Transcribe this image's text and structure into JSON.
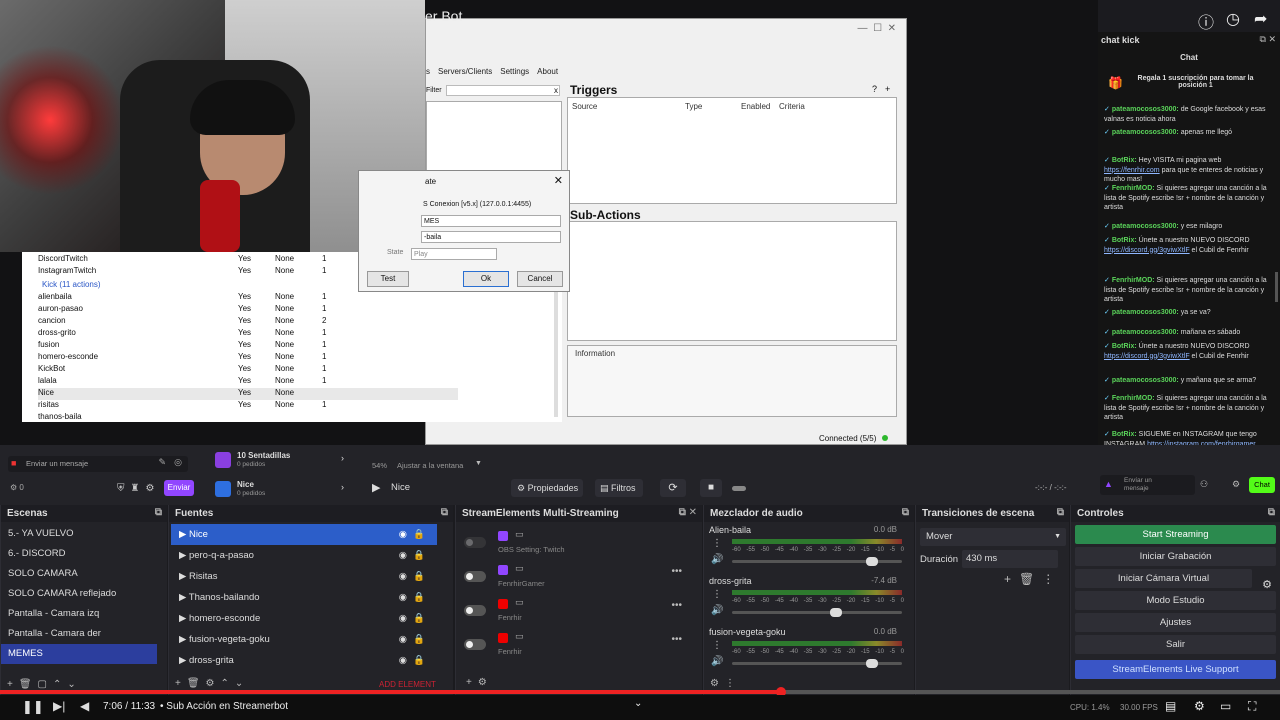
{
  "app": {
    "title": "er Bot"
  },
  "topicons": [
    "info-icon",
    "clock-icon",
    "share-icon"
  ],
  "sb": {
    "menu": [
      "s",
      "Servers/Clients",
      "Settings",
      "About"
    ],
    "filter_label": "Filter",
    "triggers_title": "Triggers",
    "trigger_cols": [
      "Source",
      "Type",
      "Enabled",
      "Criteria"
    ],
    "subactions_title": "Sub-Actions",
    "information_label": "Information",
    "status": "Connected (5/5)",
    "actions": [
      {
        "name": "DiscordTwitch",
        "enabled": "Yes",
        "group": "None",
        "count": "1"
      },
      {
        "name": "InstagramTwitch",
        "enabled": "Yes",
        "group": "None",
        "count": "1"
      }
    ],
    "kick_group": "Kick (11 actions)",
    "kick_actions": [
      {
        "name": "alienbaila",
        "enabled": "Yes",
        "group": "None",
        "count": "1"
      },
      {
        "name": "auron-pasao",
        "enabled": "Yes",
        "group": "None",
        "count": "1"
      },
      {
        "name": "cancion",
        "enabled": "Yes",
        "group": "None",
        "count": "2"
      },
      {
        "name": "dross-grito",
        "enabled": "Yes",
        "group": "None",
        "count": "1"
      },
      {
        "name": "fusion",
        "enabled": "Yes",
        "group": "None",
        "count": "1"
      },
      {
        "name": "homero-esconde",
        "enabled": "Yes",
        "group": "None",
        "count": "1"
      },
      {
        "name": "KickBot",
        "enabled": "Yes",
        "group": "None",
        "count": "1"
      },
      {
        "name": "lalala",
        "enabled": "Yes",
        "group": "None",
        "count": "1"
      },
      {
        "name": "Nice",
        "enabled": "Yes",
        "group": "None",
        "count": ""
      },
      {
        "name": "risitas",
        "enabled": "Yes",
        "group": "None",
        "count": "1"
      },
      {
        "name": "thanos-baila",
        "enabled": "",
        "group": "",
        "count": ""
      }
    ]
  },
  "dialog": {
    "title": "ate",
    "connection": "S Conexion [v5.x] (127.0.0.1:4455)",
    "scene": "MES",
    "source": "-baila",
    "state_label": "State",
    "state_value": "Play",
    "test": "Test",
    "ok": "Ok",
    "cancel": "Cancel"
  },
  "chat": {
    "title": "chat kick",
    "subtitle": "Chat",
    "pinned": "Regala 1 suscripción para tomar la posición 1",
    "messages": [
      {
        "user": "pateamocosos3000:",
        "text": "de Google facebook y esas valnas es noticia ahora"
      },
      {
        "user": "pateamocosos3000:",
        "text": "apenas me llegó"
      },
      {
        "user": "BotRix:",
        "text": "Hey VISITA mi pagina web",
        "link": "https://fenrhir.com",
        "tail": "para que te enteres de noticias y mucho mas!"
      },
      {
        "user": "FenrhirMOD:",
        "text": "Si quieres agregar una canción a la lista de Spotify escribe !sr + nombre de la canción y artista"
      },
      {
        "user": "pateamocosos3000:",
        "text": "y ese milagro"
      },
      {
        "user": "BotRix:",
        "text": "Únete a nuestro NUEVO DISCORD",
        "link": "https://discord.gg/3gviwXtlF",
        "tail": "el Cubil de Fenrhir"
      },
      {
        "user": "FenrhirMOD:",
        "text": "Si quieres agregar una canción a la lista de Spotify escribe !sr + nombre de la canción y artista"
      },
      {
        "user": "pateamocosos3000:",
        "text": "ya se va?"
      },
      {
        "user": "pateamocosos3000:",
        "text": "mañana es sábado"
      },
      {
        "user": "BotRix:",
        "text": "Únete a nuestro NUEVO DISCORD",
        "link": "https://discord.gg/3gviwXtlF",
        "tail": "el Cubil de Fenrhir"
      },
      {
        "user": "pateamocosos3000:",
        "text": "y mañana que se arma?"
      },
      {
        "user": "FenrhirMOD:",
        "text": "Si quieres agregar una canción a la lista de Spotify escribe !sr + nombre de la canción y artista"
      },
      {
        "user": "BotRix:",
        "text": "SIGUEME en INSTAGRAM que tengo INSTAGRAM",
        "link": "https://instagram.com/fenrhirgamer",
        "tail": ""
      }
    ],
    "input_placeholder": "Envíar un mensaje",
    "chat_button": "Chat"
  },
  "toolbar": {
    "msg_placeholder": "Enviar un mensaje",
    "send": "Enviar",
    "counts": "0",
    "goal1_title": "10 Sentadillas",
    "goal1_sub": "0 pedidos",
    "goal2_title": "Nice",
    "goal2_sub": "0 pedidos",
    "zoom": "54%",
    "fit": "Ajustar a la ventana",
    "current_source": "Nice",
    "properties": "Propiedades",
    "filters": "Filtros",
    "time": "-:-:- / -:-:-"
  },
  "scenes": {
    "title": "Escenas",
    "items": [
      "5.- YA VUELVO",
      "6.- DISCORD",
      "SOLO CAMARA",
      "SOLO CAMARA reflejado",
      "Pantalla - Camara izq",
      "Pantalla - Camara der",
      "MEMES"
    ],
    "selected": "MEMES"
  },
  "sources": {
    "title": "Fuentes",
    "items": [
      "Nice",
      "pero-q-a-pasao",
      "Risitas",
      "Thanos-bailando",
      "homero-esconde",
      "fusion-vegeta-goku",
      "dross-grita"
    ],
    "add_element": "ADD ELEMENT"
  },
  "multistream": {
    "title": "StreamElements Multi-Streaming",
    "items": [
      {
        "label": "OBS Setting: Twitch",
        "platform": "twitch"
      },
      {
        "label": "FenrhirGamer",
        "platform": "twitch"
      },
      {
        "label": "Fenrhir",
        "platform": "youtube"
      },
      {
        "label": "Fenrhir",
        "platform": "youtube"
      }
    ]
  },
  "mixer": {
    "title": "Mezclador de audio",
    "channels": [
      {
        "name": "Alien-baila",
        "db": "0.0 dB",
        "level": 0.85
      },
      {
        "name": "dross-grita",
        "db": "-7.4 dB",
        "level": 0.62
      },
      {
        "name": "fusion-vegeta-goku",
        "db": "0.0 dB",
        "level": 0.85
      }
    ],
    "ticks": [
      "-60",
      "-55",
      "-50",
      "-45",
      "-40",
      "-35",
      "-30",
      "-25",
      "-20",
      "-15",
      "-10",
      "-5",
      "0"
    ]
  },
  "transitions": {
    "title": "Transiciones de escena",
    "type": "Mover",
    "duration_label": "Duración",
    "duration_value": "430 ms"
  },
  "controls": {
    "title": "Controles",
    "buttons": [
      "Iniciar Grabación",
      "Iniciar Cámara Virtual",
      "Modo Estudio",
      "Ajustes",
      "Salir"
    ],
    "start": "Start Streaming",
    "support": "StreamElements Live Support"
  },
  "player": {
    "time": "7:06 / 11:33",
    "chapter": "• Sub Acción en Streamerbot",
    "progress": 0.61,
    "cpu": "CPU: 1.4%",
    "fps": "30.00 FPS"
  }
}
